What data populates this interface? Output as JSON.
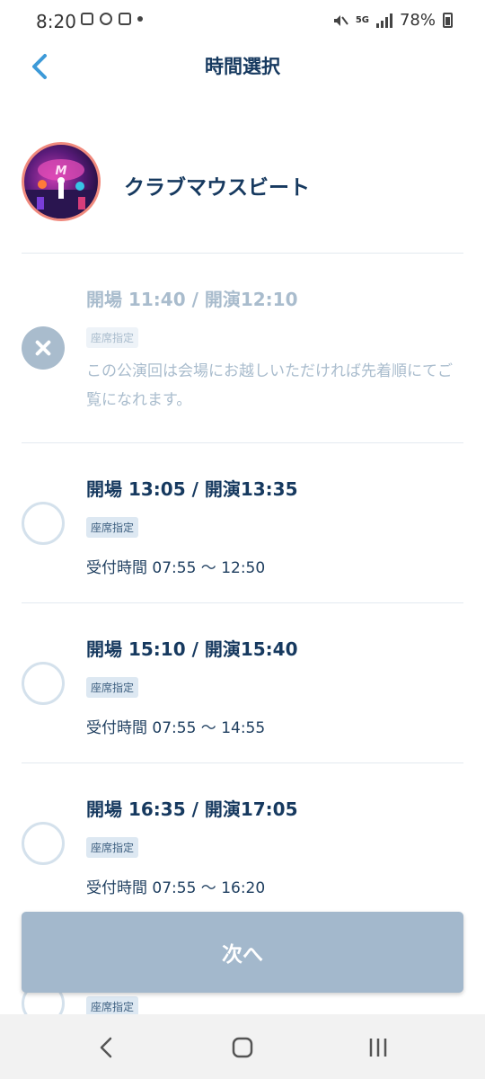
{
  "status_bar": {
    "time": "8:20",
    "network": "5G",
    "battery": "78%"
  },
  "header": {
    "title": "時間選択",
    "back_icon": "chevron-left-icon"
  },
  "show": {
    "name": "クラブマウスビート",
    "avatar": "show-thumbnail"
  },
  "slots": [
    {
      "time": "開場 11:40 / 開演12:10",
      "badge": "座席指定",
      "note": "この公演回は会場にお越しいただければ先着順にてご覧になれます。",
      "available": false
    },
    {
      "time": "開場 13:05 / 開演13:35",
      "badge": "座席指定",
      "reception": "受付時間 07:55 〜 12:50",
      "available": true
    },
    {
      "time": "開場 15:10 / 開演15:40",
      "badge": "座席指定",
      "reception": "受付時間 07:55 〜 14:55",
      "available": true
    },
    {
      "time": "開場 16:35 / 開演17:05",
      "badge": "座席指定",
      "reception": "受付時間 07:55 〜 16:20",
      "available": true
    },
    {
      "badge": "座席指定",
      "available": true
    }
  ],
  "next_button": {
    "label": "次へ"
  },
  "colors": {
    "primary_text": "#16395f",
    "disabled": "#a9bccd",
    "accent_blue": "#3d9ad8",
    "button": "#a3b8cc"
  }
}
